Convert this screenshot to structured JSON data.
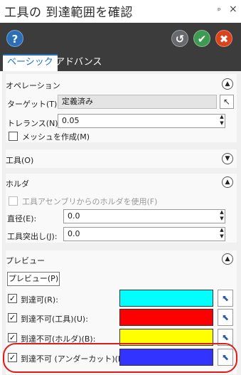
{
  "window": {
    "title": "工具の 到達範囲を確認",
    "pin_icon": "pin-icon",
    "close_icon": "close-icon"
  },
  "toolbar": {
    "help": "?",
    "reset": "↺",
    "ok": "✔",
    "cancel": "✖"
  },
  "tabs": [
    {
      "label": "ベーシック",
      "active": true
    },
    {
      "label": "アドバンス",
      "active": false
    }
  ],
  "operation": {
    "header": "オペレーション",
    "target_label": "ターゲット(T):",
    "target_value": "定義済み",
    "tolerance_label": "トレランス(N):",
    "tolerance_value": "0.05",
    "mesh_label": "メッシュを作成(M)",
    "mesh_checked": false
  },
  "tool": {
    "header": "工具(O)"
  },
  "holder": {
    "header": "ホルダ",
    "use_holder_label": "工具アセンブリからのホルダを使用(F)",
    "use_holder_checked": false,
    "diameter_label": "直径(E):",
    "diameter_value": "0.0",
    "overhang_label": "工具突出し(J):",
    "overhang_value": "0.0"
  },
  "preview": {
    "header": "プレビュー",
    "button_label": "プレビュー(P)",
    "rows": [
      {
        "label": "到達可(R):",
        "checked": true,
        "color": "#00ffff"
      },
      {
        "label": "到達不可(工具)(U):",
        "checked": true,
        "color": "#ff0000"
      },
      {
        "label": "到達不可(ホルダ)(B):",
        "checked": true,
        "color": "#ffff00"
      },
      {
        "label": "到達不可 (アンダーカット)(L):",
        "checked": true,
        "color": "#3333ff"
      }
    ]
  },
  "colors": {
    "toolbar_bg": "#3c3c3c",
    "accent": "#1e6fc2",
    "highlight": "#e21a1a"
  }
}
